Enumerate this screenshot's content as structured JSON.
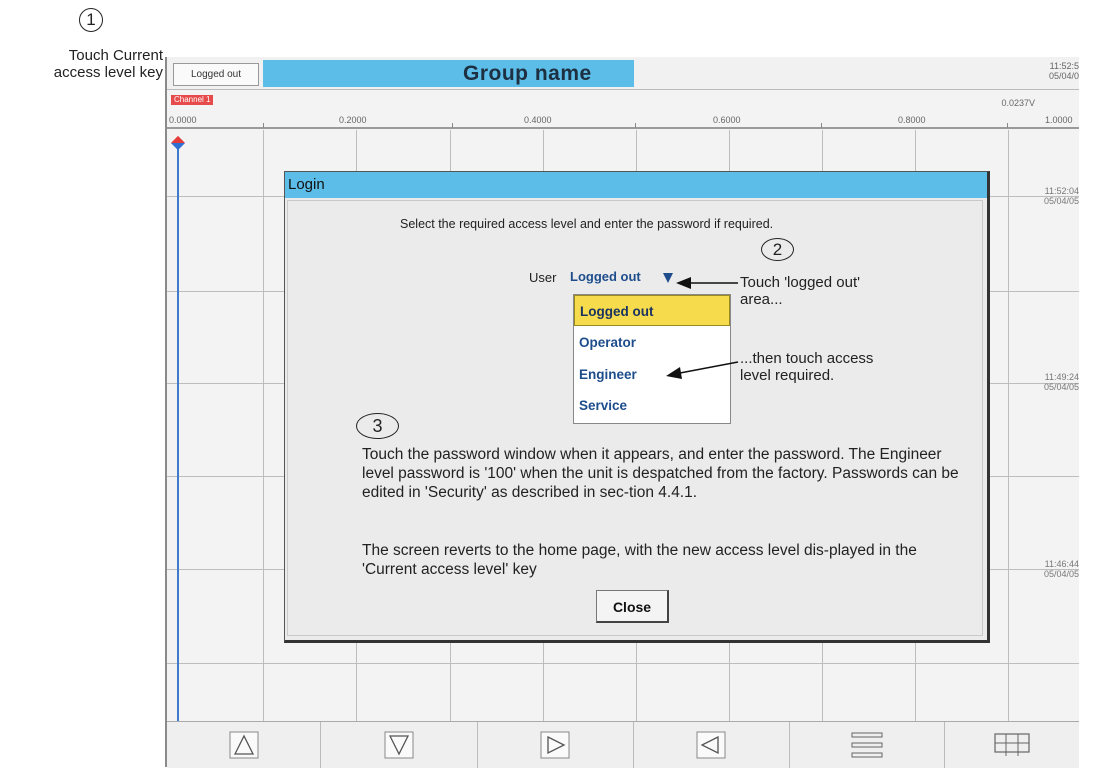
{
  "callout_1": {
    "number": "1",
    "text": "Touch Current access level key"
  },
  "topbar": {
    "access_key_label": "Logged out",
    "group_name": "Group name",
    "time": "11:52:5",
    "date": "05/04/0"
  },
  "channel": {
    "name": "Channel 1",
    "live_value": "0.0237V"
  },
  "scale": {
    "labels": [
      "0.0000",
      "0.2000",
      "0.4000",
      "0.6000",
      "0.8000",
      "1.0000"
    ]
  },
  "timestamps": [
    {
      "time": "11:52:04",
      "date": "05/04/05"
    },
    {
      "time": "11:49:24",
      "date": "05/04/05"
    },
    {
      "time": "11:46:44",
      "date": "05/04/05"
    }
  ],
  "login": {
    "title": "Login",
    "instruction": "Select the required access level and enter the password if required.",
    "user_label": "User",
    "user_value": "Logged out",
    "options": [
      "Logged out",
      "Operator",
      "Engineer",
      "Service"
    ],
    "selected_option": "Logged out",
    "close_label": "Close"
  },
  "callout_2": {
    "number": "2",
    "line1": "Touch 'logged out'",
    "line2": "area..."
  },
  "callout_access": {
    "line1": "...then touch access",
    "line2": "level required."
  },
  "callout_3": {
    "number": "3",
    "para1": "Touch the password window when it appears, and enter the password. The Engineer level password is '100' when the unit is despatched from the factory. Passwords can be edited in 'Security' as described in sec-tion 4.4.1.",
    "para2": "The screen reverts to the home page, with the new access level dis-played in the 'Current access level' key"
  },
  "nav_icons": [
    "up-triangle-icon",
    "down-triangle-icon",
    "right-triangle-icon",
    "left-triangle-icon",
    "menu-lines-icon",
    "grid-layout-icon"
  ],
  "colors": {
    "title_bar": "#5bbde8",
    "selected_option": "#f6dc4c",
    "channel": "#e64a4a",
    "trace": "#3d7bd0",
    "option_text": "#1e4d8c"
  }
}
